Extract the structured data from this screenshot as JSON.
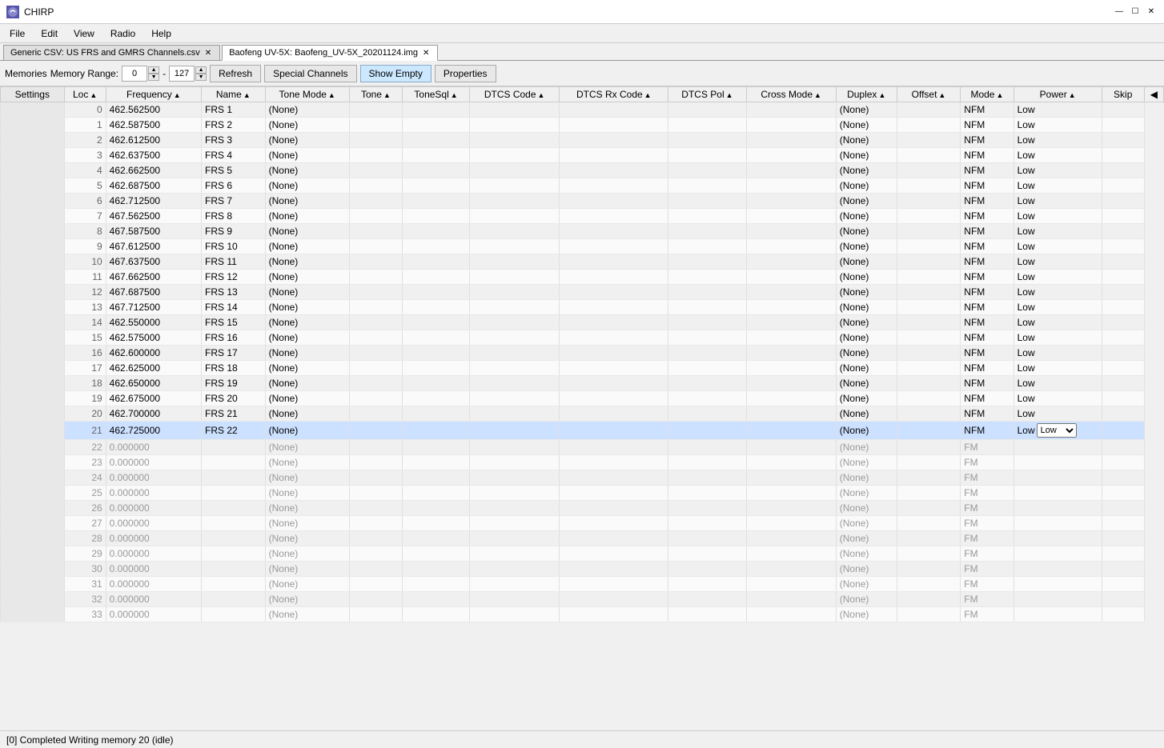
{
  "app": {
    "title": "CHIRP",
    "logo_text": "☉"
  },
  "titlebar_controls": {
    "minimize": "—",
    "maximize": "☐",
    "close": "✕"
  },
  "menu": {
    "items": [
      "File",
      "Edit",
      "View",
      "Radio",
      "Help"
    ]
  },
  "tabs": [
    {
      "id": "tab1",
      "label": "Generic CSV: US FRS and GMRS Channels.csv",
      "active": false,
      "closable": true
    },
    {
      "id": "tab2",
      "label": "Baofeng UV-5X: Baofeng_UV-5X_20201124.img",
      "active": true,
      "closable": true
    }
  ],
  "toolbar": {
    "memories_label": "Memories",
    "memory_range_label": "Memory Range:",
    "range_start": "0",
    "range_end": "127",
    "refresh_label": "Refresh",
    "special_channels_label": "Special Channels",
    "show_empty_label": "Show Empty",
    "properties_label": "Properties"
  },
  "columns": [
    {
      "id": "settings",
      "label": "Settings",
      "sortable": false
    },
    {
      "id": "loc",
      "label": "Loc",
      "sortable": true
    },
    {
      "id": "frequency",
      "label": "Frequency",
      "sortable": true
    },
    {
      "id": "name",
      "label": "Name",
      "sortable": true
    },
    {
      "id": "tone_mode",
      "label": "Tone Mode",
      "sortable": true
    },
    {
      "id": "tone",
      "label": "Tone",
      "sortable": true
    },
    {
      "id": "tonesql",
      "label": "ToneSql",
      "sortable": true
    },
    {
      "id": "dtcs_code",
      "label": "DTCS Code",
      "sortable": true
    },
    {
      "id": "dtcs_rx_code",
      "label": "DTCS Rx Code",
      "sortable": true
    },
    {
      "id": "dtcs_pol",
      "label": "DTCS Pol",
      "sortable": true
    },
    {
      "id": "cross_mode",
      "label": "Cross Mode",
      "sortable": true
    },
    {
      "id": "duplex",
      "label": "Duplex",
      "sortable": true
    },
    {
      "id": "offset",
      "label": "Offset",
      "sortable": true
    },
    {
      "id": "mode",
      "label": "Mode",
      "sortable": true
    },
    {
      "id": "power",
      "label": "Power",
      "sortable": true
    },
    {
      "id": "skip",
      "label": "Skip",
      "sortable": false
    }
  ],
  "rows": [
    {
      "loc": 0,
      "frequency": "462.562500",
      "name": "FRS 1",
      "tone_mode": "(None)",
      "tone": "",
      "tonesql": "",
      "dtcs_code": "",
      "dtcs_rx_code": "",
      "dtcs_pol": "",
      "cross_mode": "",
      "duplex": "(None)",
      "offset": "",
      "mode": "NFM",
      "power": "Low",
      "skip": "",
      "empty": false
    },
    {
      "loc": 1,
      "frequency": "462.587500",
      "name": "FRS 2",
      "tone_mode": "(None)",
      "tone": "",
      "tonesql": "",
      "dtcs_code": "",
      "dtcs_rx_code": "",
      "dtcs_pol": "",
      "cross_mode": "",
      "duplex": "(None)",
      "offset": "",
      "mode": "NFM",
      "power": "Low",
      "skip": "",
      "empty": false
    },
    {
      "loc": 2,
      "frequency": "462.612500",
      "name": "FRS 3",
      "tone_mode": "(None)",
      "tone": "",
      "tonesql": "",
      "dtcs_code": "",
      "dtcs_rx_code": "",
      "dtcs_pol": "",
      "cross_mode": "",
      "duplex": "(None)",
      "offset": "",
      "mode": "NFM",
      "power": "Low",
      "skip": "",
      "empty": false
    },
    {
      "loc": 3,
      "frequency": "462.637500",
      "name": "FRS 4",
      "tone_mode": "(None)",
      "tone": "",
      "tonesql": "",
      "dtcs_code": "",
      "dtcs_rx_code": "",
      "dtcs_pol": "",
      "cross_mode": "",
      "duplex": "(None)",
      "offset": "",
      "mode": "NFM",
      "power": "Low",
      "skip": "",
      "empty": false
    },
    {
      "loc": 4,
      "frequency": "462.662500",
      "name": "FRS 5",
      "tone_mode": "(None)",
      "tone": "",
      "tonesql": "",
      "dtcs_code": "",
      "dtcs_rx_code": "",
      "dtcs_pol": "",
      "cross_mode": "",
      "duplex": "(None)",
      "offset": "",
      "mode": "NFM",
      "power": "Low",
      "skip": "",
      "empty": false
    },
    {
      "loc": 5,
      "frequency": "462.687500",
      "name": "FRS 6",
      "tone_mode": "(None)",
      "tone": "",
      "tonesql": "",
      "dtcs_code": "",
      "dtcs_rx_code": "",
      "dtcs_pol": "",
      "cross_mode": "",
      "duplex": "(None)",
      "offset": "",
      "mode": "NFM",
      "power": "Low",
      "skip": "",
      "empty": false
    },
    {
      "loc": 6,
      "frequency": "462.712500",
      "name": "FRS 7",
      "tone_mode": "(None)",
      "tone": "",
      "tonesql": "",
      "dtcs_code": "",
      "dtcs_rx_code": "",
      "dtcs_pol": "",
      "cross_mode": "",
      "duplex": "(None)",
      "offset": "",
      "mode": "NFM",
      "power": "Low",
      "skip": "",
      "empty": false
    },
    {
      "loc": 7,
      "frequency": "467.562500",
      "name": "FRS 8",
      "tone_mode": "(None)",
      "tone": "",
      "tonesql": "",
      "dtcs_code": "",
      "dtcs_rx_code": "",
      "dtcs_pol": "",
      "cross_mode": "",
      "duplex": "(None)",
      "offset": "",
      "mode": "NFM",
      "power": "Low",
      "skip": "",
      "empty": false
    },
    {
      "loc": 8,
      "frequency": "467.587500",
      "name": "FRS 9",
      "tone_mode": "(None)",
      "tone": "",
      "tonesql": "",
      "dtcs_code": "",
      "dtcs_rx_code": "",
      "dtcs_pol": "",
      "cross_mode": "",
      "duplex": "(None)",
      "offset": "",
      "mode": "NFM",
      "power": "Low",
      "skip": "",
      "empty": false
    },
    {
      "loc": 9,
      "frequency": "467.612500",
      "name": "FRS 10",
      "tone_mode": "(None)",
      "tone": "",
      "tonesql": "",
      "dtcs_code": "",
      "dtcs_rx_code": "",
      "dtcs_pol": "",
      "cross_mode": "",
      "duplex": "(None)",
      "offset": "",
      "mode": "NFM",
      "power": "Low",
      "skip": "",
      "empty": false
    },
    {
      "loc": 10,
      "frequency": "467.637500",
      "name": "FRS 11",
      "tone_mode": "(None)",
      "tone": "",
      "tonesql": "",
      "dtcs_code": "",
      "dtcs_rx_code": "",
      "dtcs_pol": "",
      "cross_mode": "",
      "duplex": "(None)",
      "offset": "",
      "mode": "NFM",
      "power": "Low",
      "skip": "",
      "empty": false
    },
    {
      "loc": 11,
      "frequency": "467.662500",
      "name": "FRS 12",
      "tone_mode": "(None)",
      "tone": "",
      "tonesql": "",
      "dtcs_code": "",
      "dtcs_rx_code": "",
      "dtcs_pol": "",
      "cross_mode": "",
      "duplex": "(None)",
      "offset": "",
      "mode": "NFM",
      "power": "Low",
      "skip": "",
      "empty": false
    },
    {
      "loc": 12,
      "frequency": "467.687500",
      "name": "FRS 13",
      "tone_mode": "(None)",
      "tone": "",
      "tonesql": "",
      "dtcs_code": "",
      "dtcs_rx_code": "",
      "dtcs_pol": "",
      "cross_mode": "",
      "duplex": "(None)",
      "offset": "",
      "mode": "NFM",
      "power": "Low",
      "skip": "",
      "empty": false
    },
    {
      "loc": 13,
      "frequency": "467.712500",
      "name": "FRS 14",
      "tone_mode": "(None)",
      "tone": "",
      "tonesql": "",
      "dtcs_code": "",
      "dtcs_rx_code": "",
      "dtcs_pol": "",
      "cross_mode": "",
      "duplex": "(None)",
      "offset": "",
      "mode": "NFM",
      "power": "Low",
      "skip": "",
      "empty": false
    },
    {
      "loc": 14,
      "frequency": "462.550000",
      "name": "FRS 15",
      "tone_mode": "(None)",
      "tone": "",
      "tonesql": "",
      "dtcs_code": "",
      "dtcs_rx_code": "",
      "dtcs_pol": "",
      "cross_mode": "",
      "duplex": "(None)",
      "offset": "",
      "mode": "NFM",
      "power": "Low",
      "skip": "",
      "empty": false
    },
    {
      "loc": 15,
      "frequency": "462.575000",
      "name": "FRS 16",
      "tone_mode": "(None)",
      "tone": "",
      "tonesql": "",
      "dtcs_code": "",
      "dtcs_rx_code": "",
      "dtcs_pol": "",
      "cross_mode": "",
      "duplex": "(None)",
      "offset": "",
      "mode": "NFM",
      "power": "Low",
      "skip": "",
      "empty": false
    },
    {
      "loc": 16,
      "frequency": "462.600000",
      "name": "FRS 17",
      "tone_mode": "(None)",
      "tone": "",
      "tonesql": "",
      "dtcs_code": "",
      "dtcs_rx_code": "",
      "dtcs_pol": "",
      "cross_mode": "",
      "duplex": "(None)",
      "offset": "",
      "mode": "NFM",
      "power": "Low",
      "skip": "",
      "empty": false
    },
    {
      "loc": 17,
      "frequency": "462.625000",
      "name": "FRS 18",
      "tone_mode": "(None)",
      "tone": "",
      "tonesql": "",
      "dtcs_code": "",
      "dtcs_rx_code": "",
      "dtcs_pol": "",
      "cross_mode": "",
      "duplex": "(None)",
      "offset": "",
      "mode": "NFM",
      "power": "Low",
      "skip": "",
      "empty": false
    },
    {
      "loc": 18,
      "frequency": "462.650000",
      "name": "FRS 19",
      "tone_mode": "(None)",
      "tone": "",
      "tonesql": "",
      "dtcs_code": "",
      "dtcs_rx_code": "",
      "dtcs_pol": "",
      "cross_mode": "",
      "duplex": "(None)",
      "offset": "",
      "mode": "NFM",
      "power": "Low",
      "skip": "",
      "empty": false
    },
    {
      "loc": 19,
      "frequency": "462.675000",
      "name": "FRS 20",
      "tone_mode": "(None)",
      "tone": "",
      "tonesql": "",
      "dtcs_code": "",
      "dtcs_rx_code": "",
      "dtcs_pol": "",
      "cross_mode": "",
      "duplex": "(None)",
      "offset": "",
      "mode": "NFM",
      "power": "Low",
      "skip": "",
      "empty": false
    },
    {
      "loc": 20,
      "frequency": "462.700000",
      "name": "FRS 21",
      "tone_mode": "(None)",
      "tone": "",
      "tonesql": "",
      "dtcs_code": "",
      "dtcs_rx_code": "",
      "dtcs_pol": "",
      "cross_mode": "",
      "duplex": "(None)",
      "offset": "",
      "mode": "NFM",
      "power": "Low",
      "skip": "",
      "empty": false
    },
    {
      "loc": 21,
      "frequency": "462.725000",
      "name": "FRS 22",
      "tone_mode": "(None)",
      "tone": "",
      "tonesql": "",
      "dtcs_code": "",
      "dtcs_rx_code": "",
      "dtcs_pol": "",
      "cross_mode": "",
      "duplex": "(None)",
      "offset": "",
      "mode": "NFM",
      "power": "Low",
      "skip": "",
      "empty": false,
      "selected": true
    },
    {
      "loc": 22,
      "frequency": "0.000000",
      "name": "",
      "tone_mode": "(None)",
      "tone": "",
      "tonesql": "",
      "dtcs_code": "",
      "dtcs_rx_code": "",
      "dtcs_pol": "",
      "cross_mode": "",
      "duplex": "(None)",
      "offset": "",
      "mode": "FM",
      "power": "",
      "skip": "",
      "empty": true
    },
    {
      "loc": 23,
      "frequency": "0.000000",
      "name": "",
      "tone_mode": "(None)",
      "tone": "",
      "tonesql": "",
      "dtcs_code": "",
      "dtcs_rx_code": "",
      "dtcs_pol": "",
      "cross_mode": "",
      "duplex": "(None)",
      "offset": "",
      "mode": "FM",
      "power": "",
      "skip": "",
      "empty": true
    },
    {
      "loc": 24,
      "frequency": "0.000000",
      "name": "",
      "tone_mode": "(None)",
      "tone": "",
      "tonesql": "",
      "dtcs_code": "",
      "dtcs_rx_code": "",
      "dtcs_pol": "",
      "cross_mode": "",
      "duplex": "(None)",
      "offset": "",
      "mode": "FM",
      "power": "",
      "skip": "",
      "empty": true
    },
    {
      "loc": 25,
      "frequency": "0.000000",
      "name": "",
      "tone_mode": "(None)",
      "tone": "",
      "tonesql": "",
      "dtcs_code": "",
      "dtcs_rx_code": "",
      "dtcs_pol": "",
      "cross_mode": "",
      "duplex": "(None)",
      "offset": "",
      "mode": "FM",
      "power": "",
      "skip": "",
      "empty": true
    },
    {
      "loc": 26,
      "frequency": "0.000000",
      "name": "",
      "tone_mode": "(None)",
      "tone": "",
      "tonesql": "",
      "dtcs_code": "",
      "dtcs_rx_code": "",
      "dtcs_pol": "",
      "cross_mode": "",
      "duplex": "(None)",
      "offset": "",
      "mode": "FM",
      "power": "",
      "skip": "",
      "empty": true
    },
    {
      "loc": 27,
      "frequency": "0.000000",
      "name": "",
      "tone_mode": "(None)",
      "tone": "",
      "tonesql": "",
      "dtcs_code": "",
      "dtcs_rx_code": "",
      "dtcs_pol": "",
      "cross_mode": "",
      "duplex": "(None)",
      "offset": "",
      "mode": "FM",
      "power": "",
      "skip": "",
      "empty": true
    },
    {
      "loc": 28,
      "frequency": "0.000000",
      "name": "",
      "tone_mode": "(None)",
      "tone": "",
      "tonesql": "",
      "dtcs_code": "",
      "dtcs_rx_code": "",
      "dtcs_pol": "",
      "cross_mode": "",
      "duplex": "(None)",
      "offset": "",
      "mode": "FM",
      "power": "",
      "skip": "",
      "empty": true
    },
    {
      "loc": 29,
      "frequency": "0.000000",
      "name": "",
      "tone_mode": "(None)",
      "tone": "",
      "tonesql": "",
      "dtcs_code": "",
      "dtcs_rx_code": "",
      "dtcs_pol": "",
      "cross_mode": "",
      "duplex": "(None)",
      "offset": "",
      "mode": "FM",
      "power": "",
      "skip": "",
      "empty": true
    },
    {
      "loc": 30,
      "frequency": "0.000000",
      "name": "",
      "tone_mode": "(None)",
      "tone": "",
      "tonesql": "",
      "dtcs_code": "",
      "dtcs_rx_code": "",
      "dtcs_pol": "",
      "cross_mode": "",
      "duplex": "(None)",
      "offset": "",
      "mode": "FM",
      "power": "",
      "skip": "",
      "empty": true
    },
    {
      "loc": 31,
      "frequency": "0.000000",
      "name": "",
      "tone_mode": "(None)",
      "tone": "",
      "tonesql": "",
      "dtcs_code": "",
      "dtcs_rx_code": "",
      "dtcs_pol": "",
      "cross_mode": "",
      "duplex": "(None)",
      "offset": "",
      "mode": "FM",
      "power": "",
      "skip": "",
      "empty": true
    },
    {
      "loc": 32,
      "frequency": "0.000000",
      "name": "",
      "tone_mode": "(None)",
      "tone": "",
      "tonesql": "",
      "dtcs_code": "",
      "dtcs_rx_code": "",
      "dtcs_pol": "",
      "cross_mode": "",
      "duplex": "(None)",
      "offset": "",
      "mode": "FM",
      "power": "",
      "skip": "",
      "empty": true
    },
    {
      "loc": 33,
      "frequency": "0.000000",
      "name": "",
      "tone_mode": "(None)",
      "tone": "",
      "tonesql": "",
      "dtcs_code": "",
      "dtcs_rx_code": "",
      "dtcs_pol": "",
      "cross_mode": "",
      "duplex": "(None)",
      "offset": "",
      "mode": "FM",
      "power": "",
      "skip": "",
      "empty": true
    }
  ],
  "statusbar": {
    "text": "[0] Completed Writing memory 20 (idle)"
  }
}
